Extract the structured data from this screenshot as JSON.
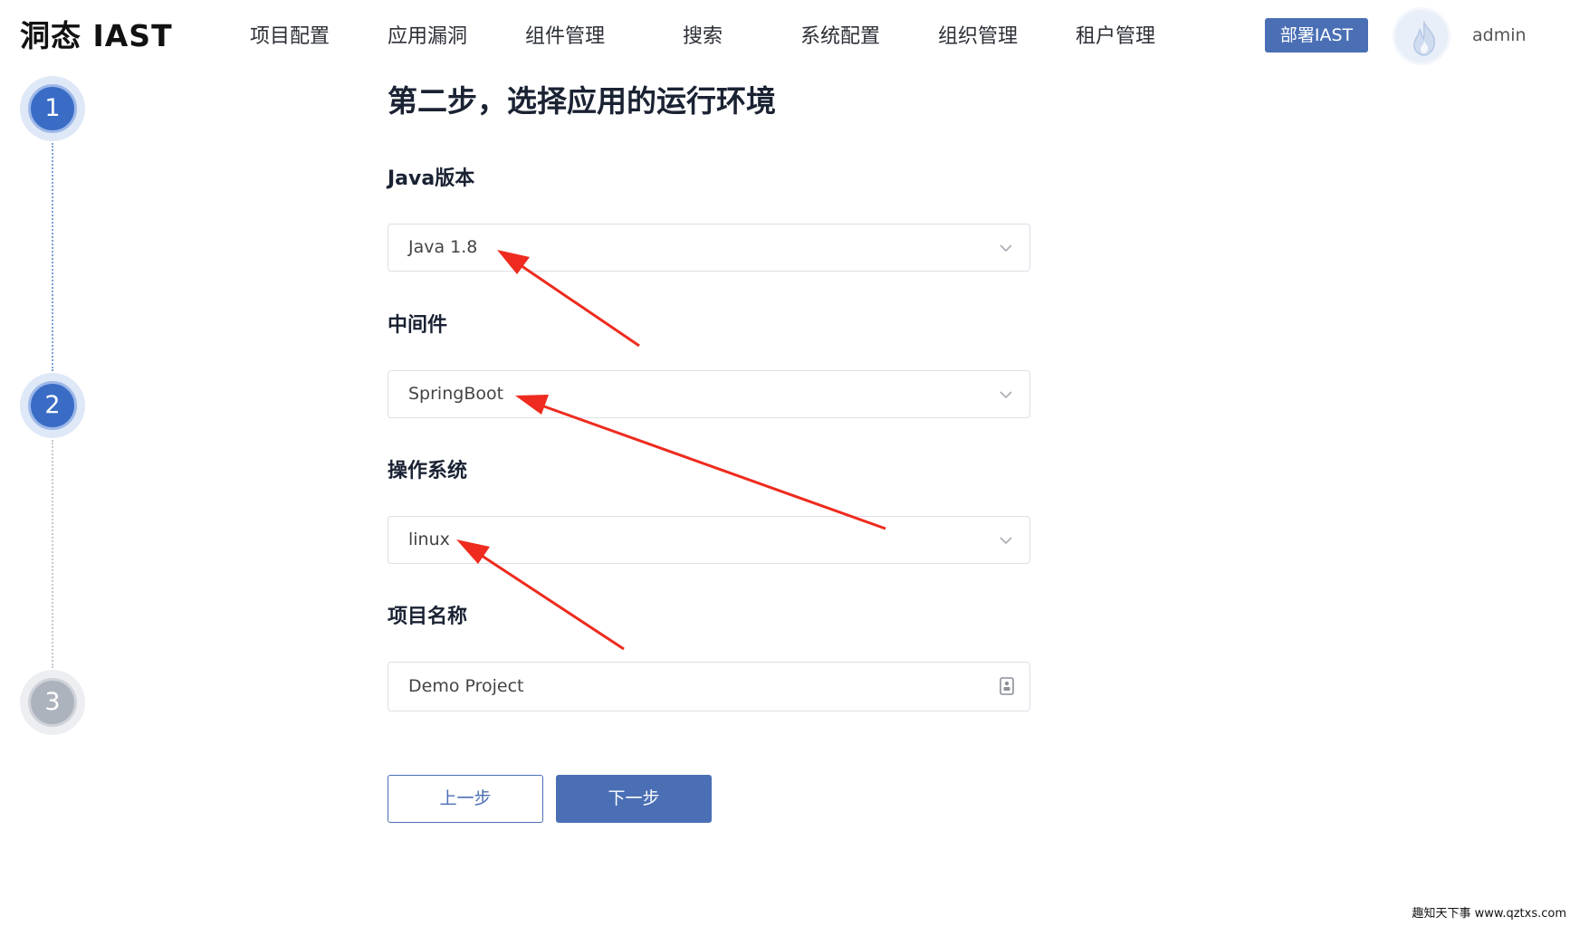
{
  "app": {
    "logo_text": "洞态 IAST",
    "nav_items": [
      "项目配置",
      "应用漏洞",
      "组件管理",
      "搜索",
      "系统配置",
      "组织管理",
      "租户管理"
    ],
    "deploy_label": "部署IAST",
    "username": "admin"
  },
  "steps": [
    {
      "number": "1",
      "state": "active"
    },
    {
      "number": "2",
      "state": "active"
    },
    {
      "number": "3",
      "state": "inactive"
    }
  ],
  "form": {
    "title": "第二步，选择应用的运行环境",
    "java_label": "Java版本",
    "java_value": "Java 1.8",
    "middleware_label": "中间件",
    "middleware_value": "SpringBoot",
    "os_label": "操作系统",
    "os_value": "linux",
    "project_label": "项目名称",
    "project_value": "Demo Project"
  },
  "buttons": {
    "prev_label": "上一步",
    "next_label": "下一步"
  },
  "icons": {
    "avatar": "flame-icon",
    "select_toggle": "chevron-down-icon",
    "input_suffix": "contact-card-icon"
  },
  "colors": {
    "primary": "#4a6fb5",
    "step_active": "#3a6cc6",
    "step_inactive": "#adb3bd",
    "annotation_arrow": "#ee2b1e"
  },
  "watermark": "趣知天下事 www.qztxs.com"
}
